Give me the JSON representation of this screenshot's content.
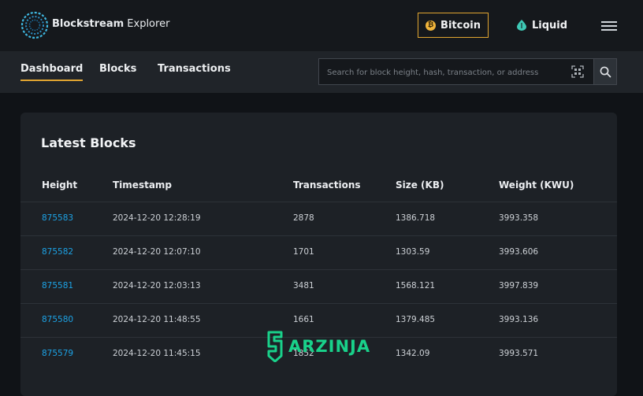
{
  "header": {
    "brand_bold": "Blockstream",
    "brand_rest": " Explorer",
    "bitcoin_label": "Bitcoin",
    "liquid_label": "Liquid",
    "accent_color": "#e1a531"
  },
  "nav": {
    "items": [
      {
        "label": "Dashboard"
      },
      {
        "label": "Blocks"
      },
      {
        "label": "Transactions"
      }
    ],
    "search_placeholder": "Search for block height, hash, transaction, or address"
  },
  "latest_blocks": {
    "title": "Latest Blocks",
    "columns": [
      "Height",
      "Timestamp",
      "Transactions",
      "Size (KB)",
      "Weight (KWU)"
    ],
    "rows": [
      {
        "height": "875583",
        "timestamp": "2024-12-20 12:28:19",
        "transactions": "2878",
        "size": "1386.718",
        "weight": "3993.358"
      },
      {
        "height": "875582",
        "timestamp": "2024-12-20 12:07:10",
        "transactions": "1701",
        "size": "1303.59",
        "weight": "3993.606"
      },
      {
        "height": "875581",
        "timestamp": "2024-12-20 12:03:13",
        "transactions": "3481",
        "size": "1568.121",
        "weight": "3997.839"
      },
      {
        "height": "875580",
        "timestamp": "2024-12-20 11:48:55",
        "transactions": "1661",
        "size": "1379.485",
        "weight": "3993.136"
      },
      {
        "height": "875579",
        "timestamp": "2024-12-20 11:45:15",
        "transactions": "1852",
        "size": "1342.09",
        "weight": "3993.571"
      }
    ]
  },
  "watermark": {
    "text": "ARZINJA"
  }
}
